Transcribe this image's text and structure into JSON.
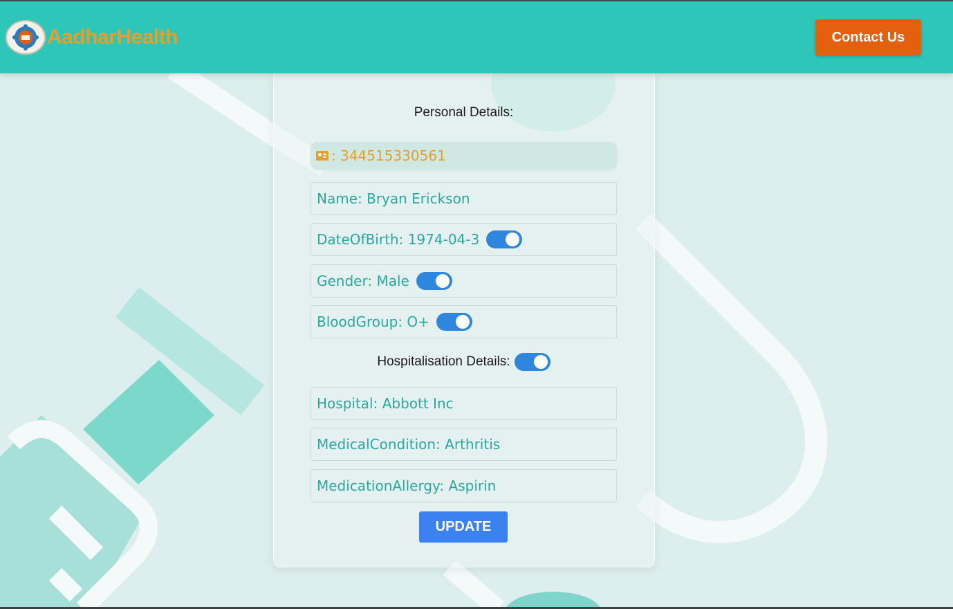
{
  "header": {
    "brand": "AadharHealth",
    "contact_label": "Contact Us"
  },
  "form": {
    "personal_title": "Personal Details:",
    "aadhar_value": ": 344515330561",
    "name": "Name: Bryan Erickson",
    "dob": "DateOfBirth: 1974-04-3",
    "gender": "Gender: Male",
    "blood_group": "BloodGroup: O+",
    "hospital_title": "Hospitalisation Details:",
    "hospital": "Hospital: Abbott Inc",
    "medical_condition": "MedicalCondition: Arthritis",
    "medication_allergy": "MedicationAllergy: Aspirin",
    "update_label": "UPDATE",
    "toggles": {
      "dob": true,
      "gender": true,
      "blood_group": true,
      "hospitalisation": true
    }
  },
  "colors": {
    "header": "#2ec6b8",
    "brand": "#e6a02a",
    "contact": "#e4600e",
    "field_text": "#2aa89c",
    "toggle": "#2e86de",
    "update": "#3b82f0"
  },
  "icons": {
    "logo": "medical-emblem-icon",
    "aadhar": "id-card-icon"
  }
}
